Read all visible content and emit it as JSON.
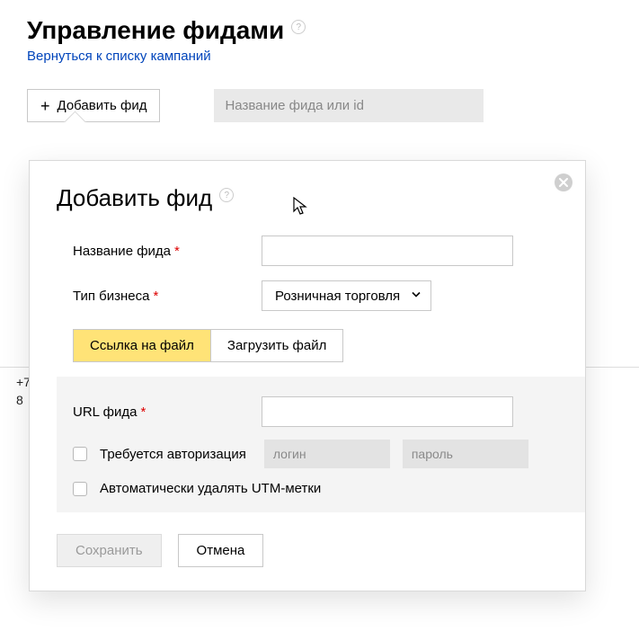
{
  "page": {
    "title": "Управление фидами",
    "back_link": "Вернуться к списку кампаний"
  },
  "toolbar": {
    "add_feed_label": "Добавить фид",
    "search_placeholder": "Название фида или id"
  },
  "footer": {
    "line1": "+7",
    "line2": "8"
  },
  "dialog": {
    "title": "Добавить фид",
    "fields": {
      "name_label": "Название фида",
      "name_value": "",
      "business_label": "Тип бизнеса",
      "business_value": "Розничная торговля",
      "url_label": "URL фида",
      "url_value": ""
    },
    "tabs": {
      "link": "Ссылка на файл",
      "upload": "Загрузить файл"
    },
    "auth": {
      "label": "Требуется авторизация",
      "login_placeholder": "логин",
      "password_placeholder": "пароль"
    },
    "utm_label": "Автоматически удалять UTM-метки",
    "actions": {
      "save": "Сохранить",
      "cancel": "Отмена"
    }
  }
}
